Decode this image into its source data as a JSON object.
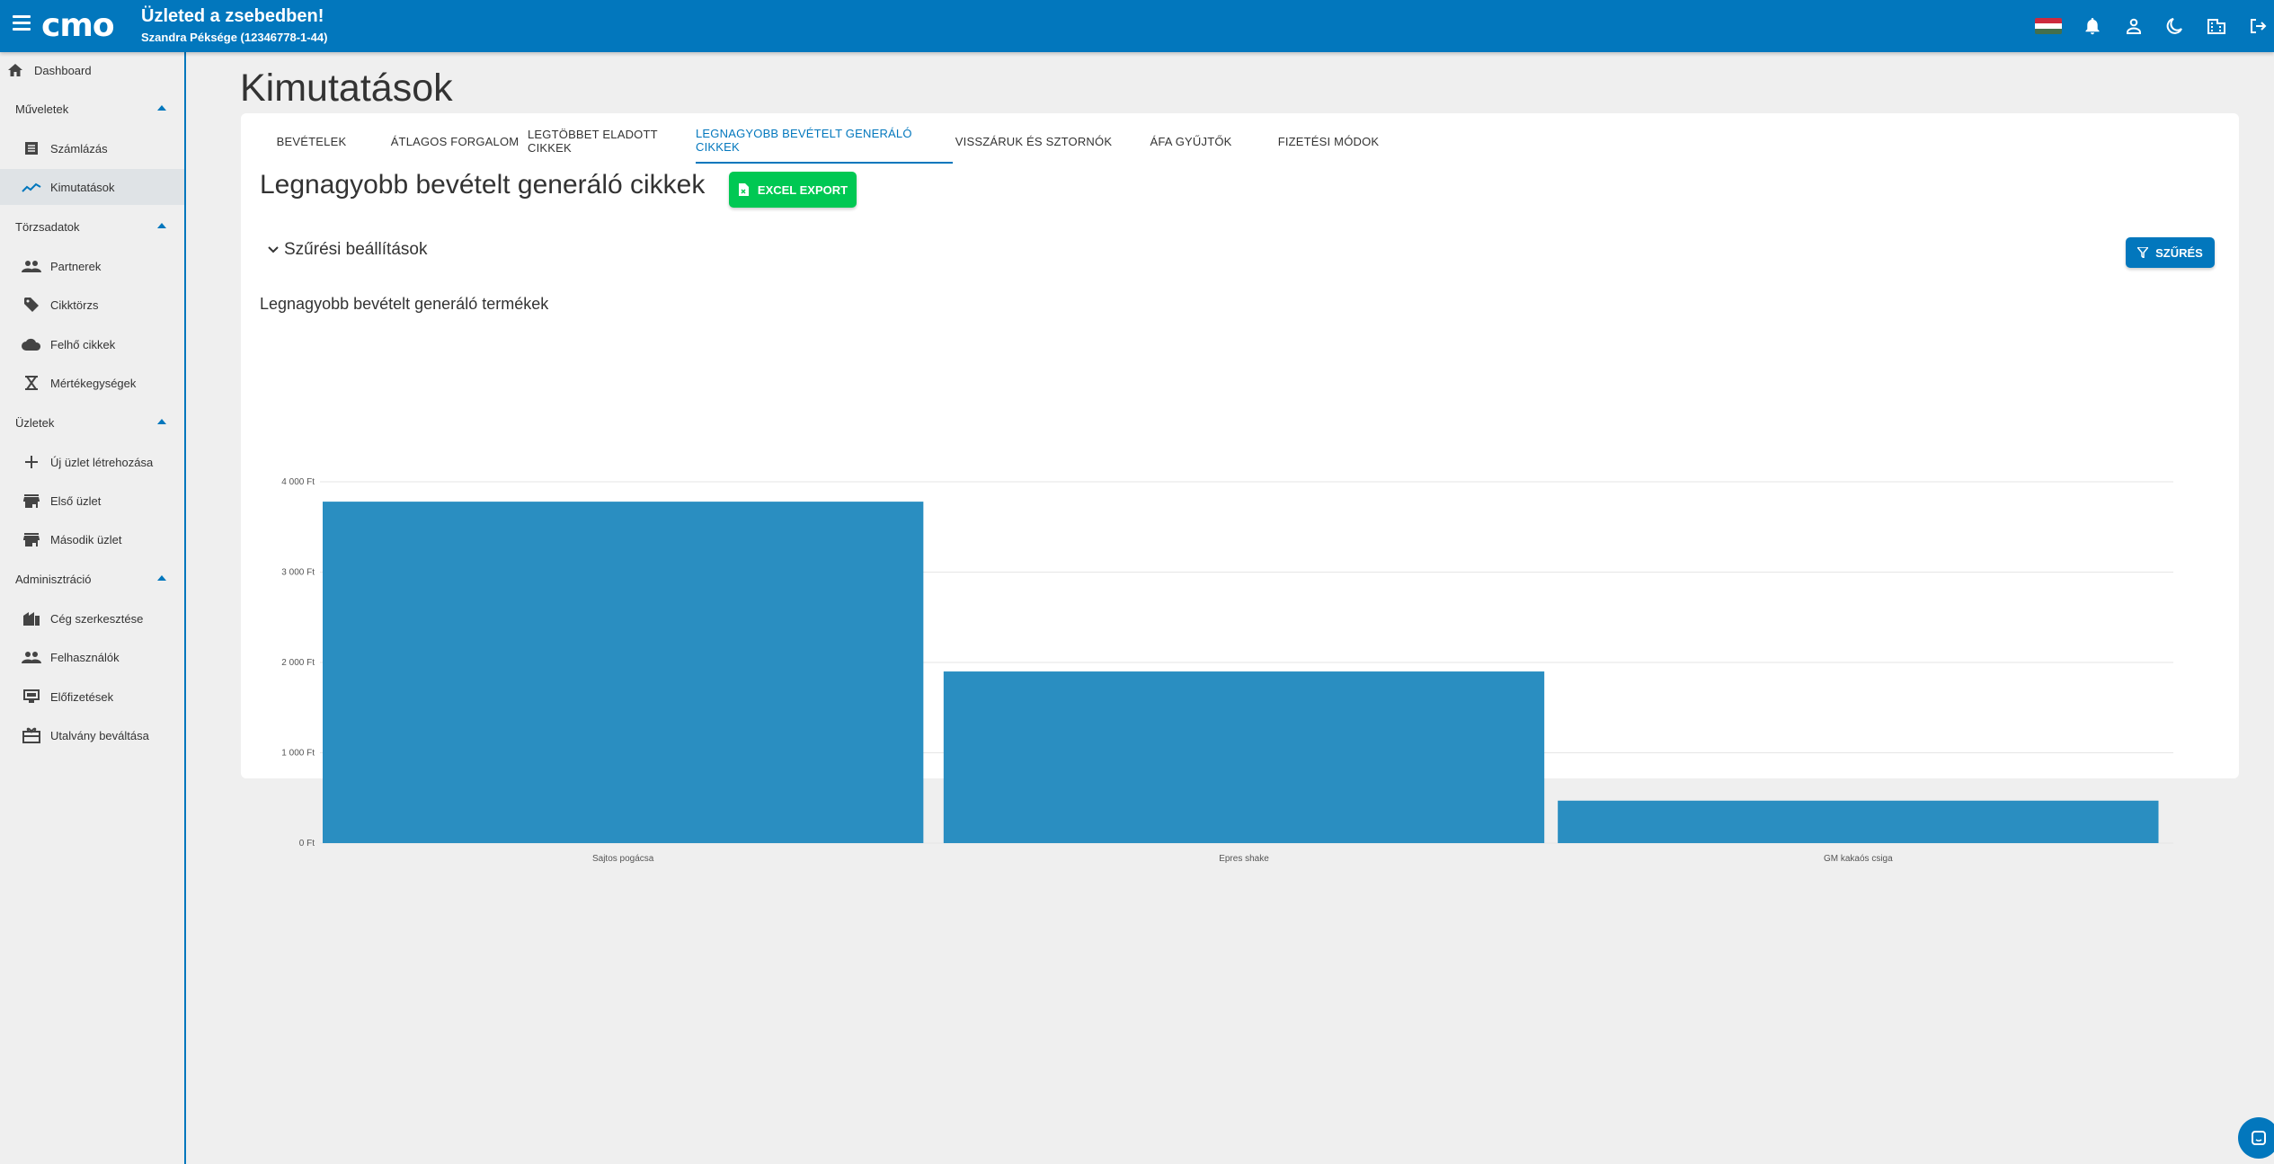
{
  "header": {
    "title": "Üzleted a zsebedben!",
    "subtitle": "Szandra Péksége (12346778-1-44)",
    "brand_color": "#0277bd"
  },
  "sidebar": {
    "dashboard": "Dashboard",
    "sections": [
      {
        "label": "Műveletek",
        "items": [
          "Számlázás",
          "Kimutatások"
        ]
      },
      {
        "label": "Törzsadatok",
        "items": [
          "Partnerek",
          "Cikktörzs",
          "Felhő cikkek",
          "Mértékegységek"
        ]
      },
      {
        "label": "Üzletek",
        "items": [
          "Új üzlet létrehozása",
          "Első üzlet",
          "Második üzlet"
        ]
      },
      {
        "label": "Adminisztráció",
        "items": [
          "Cég szerkesztése",
          "Felhasználók",
          "Előfizetések",
          "Utalvány beváltása"
        ]
      }
    ]
  },
  "page": {
    "title": "Kimutatások",
    "tabs": [
      "Bevételek",
      "Átlagos forgalom",
      "Legtöbbet eladott cikkek",
      "Legnagyobb bevételt generáló cikkek",
      "Visszáruk és sztornók",
      "ÁFA gyűjtők",
      "Fizetési módok"
    ],
    "active_tab": 3,
    "section_title": "Legnagyobb bevételt generáló cikkek",
    "excel_button": "EXCEL EXPORT",
    "filter_toggle": "Szűrési beállítások",
    "filter_button": "SZŰRÉS",
    "chart_title": "Legnagyobb bevételt generáló termékek"
  },
  "chart_data": {
    "type": "bar",
    "title": "Legnagyobb bevételt generáló termékek",
    "categories": [
      "Sajtos pogácsa",
      "Epres shake",
      "GM kakaós csiga"
    ],
    "values": [
      3780,
      1900,
      470
    ],
    "ylim": [
      0,
      4000
    ],
    "yticks": [
      0,
      1000,
      2000,
      3000,
      4000
    ],
    "ytick_labels": [
      "0 Ft",
      "1 000 Ft",
      "2 000 Ft",
      "3 000 Ft",
      "4 000 Ft"
    ],
    "grid": true,
    "bar_color": "#2a8ec1"
  }
}
